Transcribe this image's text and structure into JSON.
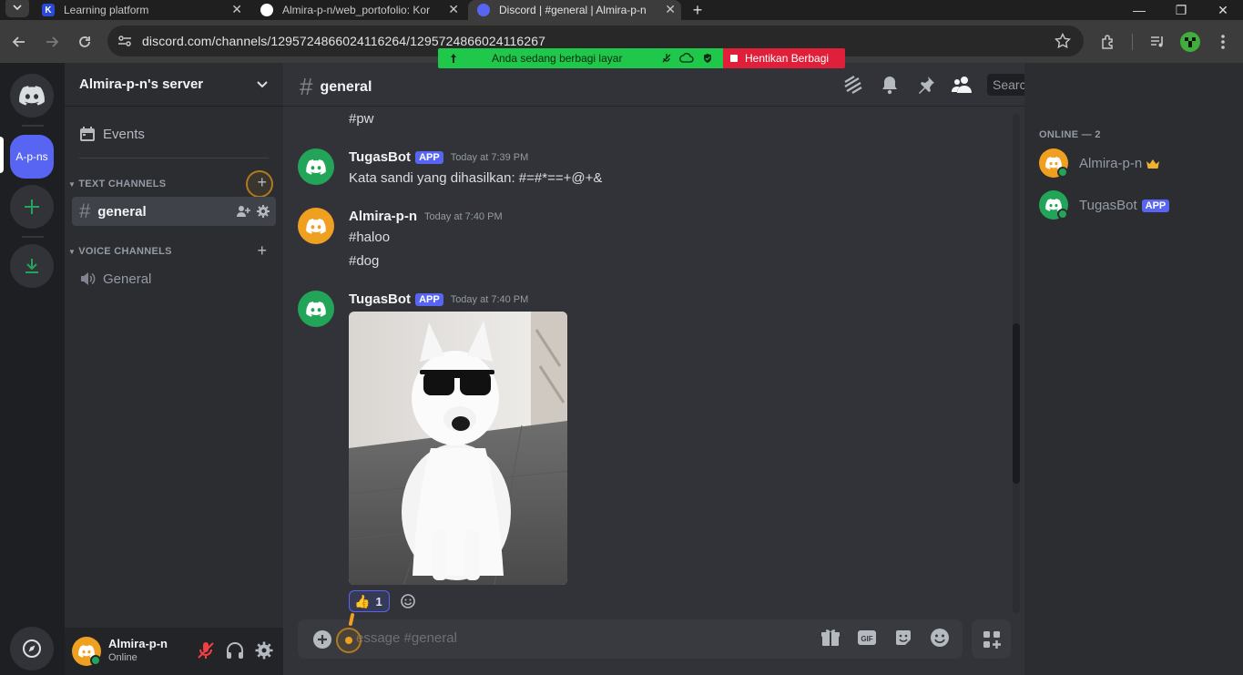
{
  "browser": {
    "tabs": [
      {
        "label": "Learning platform",
        "favicon": "K"
      },
      {
        "label": "Almira-p-n/web_portofolio: Kor",
        "favicon": "github"
      },
      {
        "label": "Discord | #general | Almira-p-n",
        "favicon": "discord"
      }
    ],
    "url": "discord.com/channels/1295724866024116264/1295724866024116267"
  },
  "share_bar": {
    "message": "Anda sedang berbagi layar",
    "stop_label": "Hentikan Berbagi"
  },
  "guilds": {
    "server_abbrev": "A-p-ns"
  },
  "sidebar": {
    "server_name": "Almira-p-n's server",
    "events_label": "Events",
    "text_category": "TEXT CHANNELS",
    "voice_category": "VOICE CHANNELS",
    "text_channels": [
      {
        "name": "general"
      }
    ],
    "voice_channels": [
      {
        "name": "General"
      }
    ]
  },
  "user_panel": {
    "name": "Almira-p-n",
    "status": "Online"
  },
  "chat": {
    "channel": "general",
    "search_placeholder": "Search",
    "composer_placeholder": "essage #general",
    "messages": [
      {
        "text": "#pw"
      },
      {
        "author": "TugasBot",
        "tag": "APP",
        "time": "Today at 7:39 PM",
        "lines": [
          "Kata sandi yang dihasilkan: #=#*==+@+&"
        ]
      },
      {
        "author": "Almira-p-n",
        "time": "Today at 7:40 PM",
        "lines": [
          "#haloo",
          "#dog"
        ]
      },
      {
        "author": "TugasBot",
        "tag": "APP",
        "time": "Today at 7:40 PM",
        "image": "dog-with-sunglasses",
        "reaction": {
          "emoji": "👍",
          "count": "1"
        }
      }
    ]
  },
  "members": {
    "header": "ONLINE — 2",
    "list": [
      {
        "name": "Almira-p-n",
        "crown": true
      },
      {
        "name": "TugasBot",
        "tag": "APP"
      }
    ]
  },
  "colors": {
    "blurple": "#5865f2",
    "green": "#23a559",
    "share_green": "#1fc74a",
    "share_red": "#e0203a",
    "avatar_orange": "#f0a020"
  }
}
